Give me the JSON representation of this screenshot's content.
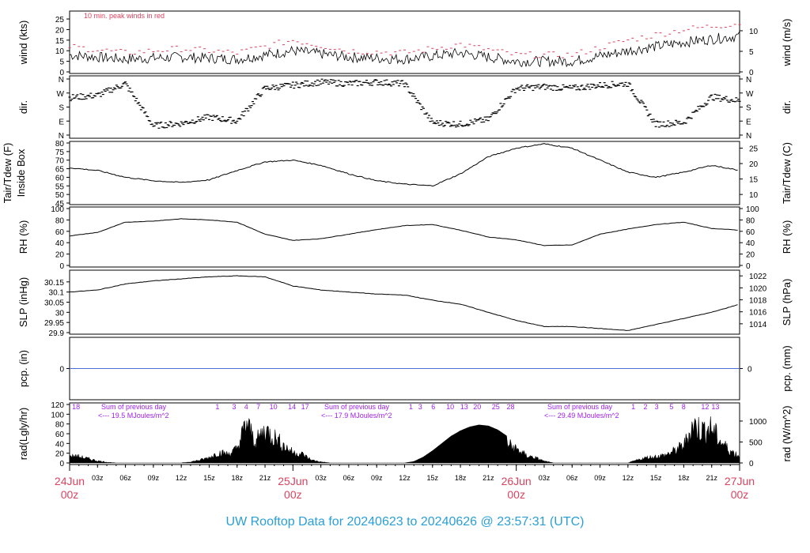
{
  "title": "UW Rooftop Data for 20240623  to  20240626 @ 23:57:31  (UTC)",
  "colors": {
    "title": "#2a9fd6",
    "date_label": "#d9435f",
    "peak_wind": "#d9435f",
    "radiation_annotation": "#a020f0",
    "precip_line": "#4a6fd6",
    "series": "#000000"
  },
  "chart_data": [
    {
      "type": "line",
      "name": "wind",
      "ylabel": "wind (kts)",
      "ylabel_right": "wind (m/s)",
      "yticks": [
        0,
        5,
        10,
        15,
        20,
        25
      ],
      "yticks_right": [
        0,
        5,
        10
      ],
      "ylim": [
        0,
        28
      ],
      "annotation": "10 min. peak winds in red",
      "x_hours": [
        0,
        6,
        12,
        18,
        24,
        30,
        36,
        42,
        48,
        54,
        60,
        66,
        72
      ],
      "series": [
        {
          "values": [
            8,
            6,
            7,
            6,
            10,
            7,
            6,
            9,
            5,
            5,
            10,
            14,
            17
          ]
        },
        {
          "values": [
            12,
            9,
            11,
            9,
            15,
            10,
            9,
            13,
            8,
            8,
            15,
            20,
            23
          ]
        }
      ]
    },
    {
      "type": "scatter",
      "name": "dir",
      "ylabel": "dir.",
      "ylabel_right": "dir.",
      "yticks": [
        "N",
        "W",
        "S",
        "E",
        "N"
      ],
      "x_hours": [
        0,
        3,
        6,
        9,
        12,
        15,
        18,
        21,
        24,
        27,
        30,
        33,
        36,
        39,
        42,
        45,
        48,
        51,
        54,
        57,
        60,
        63,
        66,
        69,
        72
      ],
      "values": [
        240,
        255,
        330,
        60,
        75,
        115,
        90,
        300,
        320,
        340,
        330,
        340,
        330,
        80,
        70,
        100,
        300,
        310,
        300,
        320,
        330,
        70,
        80,
        245,
        220
      ]
    },
    {
      "type": "line",
      "name": "temp",
      "ylabel": "Tair/Tdew (F)",
      "ylabel_inside": "Inside Box",
      "ylabel_right": "Tair/Tdew (C)",
      "yticks": [
        45,
        50,
        55,
        60,
        65,
        70,
        75,
        80
      ],
      "yticks_right": [
        10,
        15,
        20,
        25
      ],
      "ylim": [
        45,
        80
      ],
      "x_hours": [
        0,
        3,
        6,
        9,
        12,
        15,
        18,
        21,
        24,
        27,
        30,
        33,
        36,
        39,
        42,
        45,
        48,
        51,
        54,
        57,
        60,
        63,
        66,
        69,
        72
      ],
      "values": [
        65.5,
        64,
        60,
        58,
        57,
        58.5,
        64,
        69,
        70,
        67,
        62,
        58,
        56,
        55,
        62,
        72,
        77,
        79.5,
        77,
        70,
        63,
        60,
        63,
        67,
        64
      ]
    },
    {
      "type": "line",
      "name": "rh",
      "ylabel": "RH (%)",
      "ylabel_right": "RH (%)",
      "yticks": [
        0,
        20,
        40,
        60,
        80,
        100
      ],
      "ylim": [
        0,
        100
      ],
      "x_hours": [
        0,
        3,
        6,
        9,
        12,
        15,
        18,
        21,
        24,
        27,
        30,
        33,
        36,
        39,
        42,
        45,
        48,
        51,
        54,
        57,
        60,
        63,
        66,
        69,
        72
      ],
      "values": [
        52,
        58,
        76,
        78,
        82,
        80,
        76,
        55,
        44,
        47,
        55,
        63,
        70,
        72,
        62,
        50,
        45,
        35,
        36,
        55,
        64,
        72,
        76,
        65,
        62
      ]
    },
    {
      "type": "line",
      "name": "slp",
      "ylabel": "SLP (inHg)",
      "ylabel_right": "SLP (hPa)",
      "yticks": [
        29.9,
        29.95,
        30.0,
        30.05,
        30.1,
        30.15
      ],
      "yticks_right": [
        1014,
        1016,
        1018,
        1020,
        1022
      ],
      "ylim": [
        29.9,
        30.2
      ],
      "x_hours": [
        0,
        3,
        6,
        9,
        12,
        15,
        18,
        21,
        24,
        27,
        30,
        33,
        36,
        39,
        42,
        45,
        48,
        51,
        54,
        57,
        60,
        63,
        66,
        69,
        72
      ],
      "values": [
        30.1,
        30.11,
        30.14,
        30.155,
        30.165,
        30.175,
        30.18,
        30.175,
        30.13,
        30.11,
        30.1,
        30.09,
        30.085,
        30.06,
        30.04,
        30.0,
        29.96,
        29.93,
        29.93,
        29.92,
        29.91,
        29.94,
        29.97,
        30.0,
        30.04
      ]
    },
    {
      "type": "line",
      "name": "pcp",
      "ylabel": "pcp. (in)",
      "ylabel_right": "pcp. (mm)",
      "yticks": [
        0
      ],
      "yticks_right": [
        0
      ],
      "x_hours": [
        0,
        72
      ],
      "values": [
        0,
        0
      ]
    },
    {
      "type": "area",
      "name": "rad",
      "ylabel": "rad(Lgly/hr)",
      "ylabel_right": "rad (W/m^2)",
      "yticks": [
        0,
        20,
        40,
        60,
        80,
        100,
        120
      ],
      "yticks_right": [
        0,
        500,
        1000
      ],
      "ylim": [
        0,
        120
      ],
      "x_hours": [
        0,
        1,
        2,
        3,
        4,
        5,
        6,
        12,
        13,
        14,
        15,
        16,
        17,
        18,
        19,
        20,
        21,
        22,
        23,
        24,
        25,
        26,
        27,
        28,
        29,
        30,
        36,
        37,
        38,
        39,
        40,
        41,
        42,
        43,
        44,
        45,
        46,
        47,
        48,
        49,
        50,
        51,
        52,
        53,
        54,
        60,
        61,
        62,
        63,
        64,
        65,
        66,
        67,
        68,
        69,
        70,
        71,
        72
      ],
      "values": [
        20,
        18,
        12,
        6,
        2,
        0,
        0,
        0,
        3,
        8,
        15,
        30,
        25,
        40,
        115,
        60,
        95,
        75,
        50,
        30,
        25,
        8,
        3,
        0,
        0,
        0,
        0,
        3,
        12,
        25,
        40,
        55,
        66,
        74,
        78,
        76,
        68,
        55,
        40,
        22,
        15,
        5,
        0,
        0,
        0,
        0,
        8,
        15,
        18,
        22,
        35,
        50,
        110,
        95,
        100,
        60,
        35,
        20
      ],
      "annotations": [
        {
          "label": "Sum of previous day",
          "text": "<--- 19.5 MJoules/m^2"
        },
        {
          "label": "Sum of previous day",
          "text": "<--- 17.9 MJoules/m^2"
        },
        {
          "label": "Sum of previous day",
          "text": "<--- 29.49 MJoules/m^2"
        }
      ],
      "hour_marks": [
        [
          "18",
          "1",
          "3",
          "4",
          "7",
          "10",
          "14",
          "17"
        ],
        [
          "1",
          "3",
          "6",
          "10",
          "13",
          "20",
          "25",
          "28"
        ],
        [
          "1",
          "2",
          "3",
          "5",
          "8",
          "12",
          "13"
        ]
      ]
    }
  ],
  "x_axis": {
    "ticks": [
      "03z",
      "06z",
      "09z",
      "12z",
      "15z",
      "18z",
      "21z",
      "03z",
      "06z",
      "09z",
      "12z",
      "15z",
      "18z",
      "21z",
      "03z",
      "06z",
      "09z",
      "12z",
      "15z",
      "18z",
      "21z"
    ],
    "dates": [
      {
        "day": "24Jun",
        "hour": "00z"
      },
      {
        "day": "25Jun",
        "hour": "00z"
      },
      {
        "day": "26Jun",
        "hour": "00z"
      },
      {
        "day": "27Jun",
        "hour": "00z"
      }
    ]
  }
}
